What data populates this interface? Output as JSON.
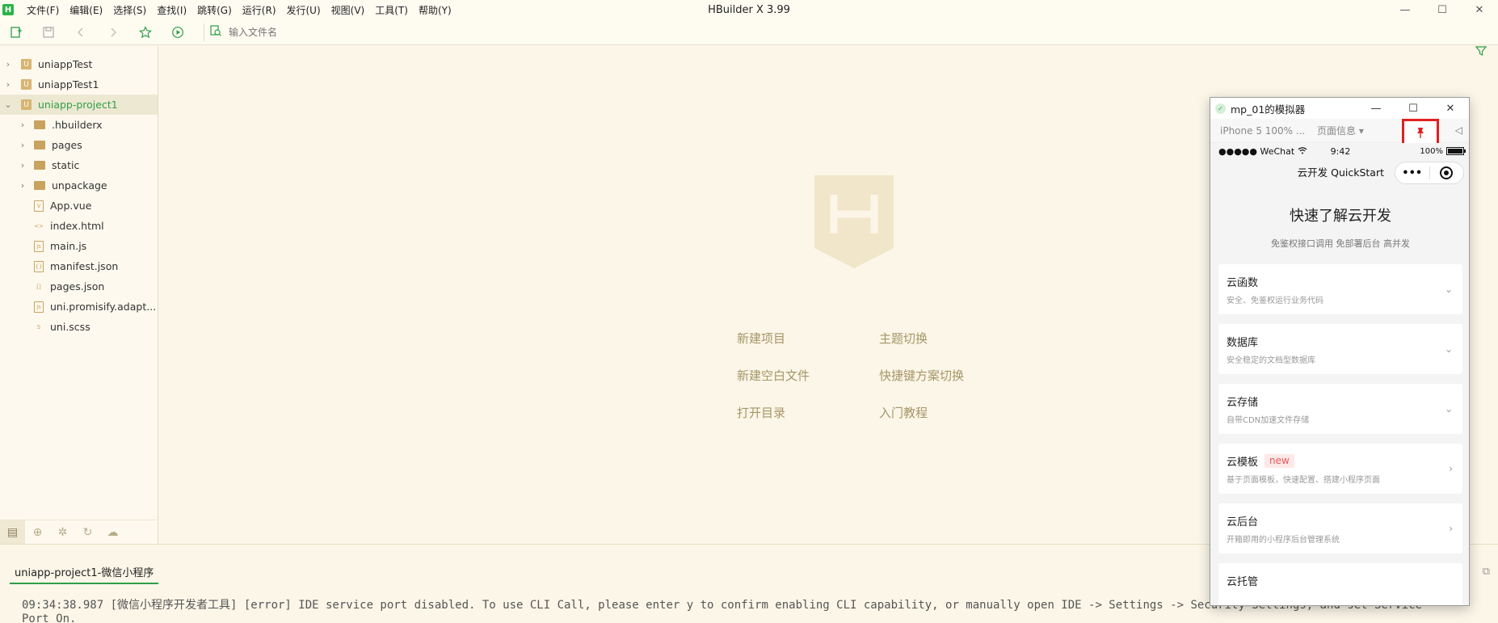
{
  "app": {
    "title": "HBuilder X 3.99",
    "logo_letter": "H",
    "menu": [
      "文件(F)",
      "编辑(E)",
      "选择(S)",
      "查找(I)",
      "跳转(G)",
      "运行(R)",
      "发行(U)",
      "视图(V)",
      "工具(T)",
      "帮助(Y)"
    ]
  },
  "toolbar": {
    "search_placeholder": "输入文件名"
  },
  "sidebar": {
    "projects": [
      {
        "label": "uniappTest",
        "expanded": false,
        "selected": false
      },
      {
        "label": "uniappTest1",
        "expanded": false,
        "selected": false
      },
      {
        "label": "uniapp-project1",
        "expanded": true,
        "selected": true
      }
    ],
    "folders": [
      ".hbuilderx",
      "pages",
      "static",
      "unpackage"
    ],
    "files": [
      {
        "label": "App.vue",
        "icon": "V"
      },
      {
        "label": "index.html",
        "icon": "<>"
      },
      {
        "label": "main.js",
        "icon": "js"
      },
      {
        "label": "manifest.json",
        "icon": "{}"
      },
      {
        "label": "pages.json",
        "icon": "[]"
      },
      {
        "label": "uni.promisify.adapt...",
        "icon": "js"
      },
      {
        "label": "uni.scss",
        "icon": "S"
      }
    ]
  },
  "welcome": {
    "links": [
      "新建项目",
      "主题切换",
      "新建空白文件",
      "快捷键方案切换",
      "打开目录",
      "入门教程"
    ]
  },
  "console": {
    "tab_label": "uniapp-project1-微信小程序",
    "line1": "09:34:38.987 [微信小程序开发者工具] [error] IDE service port disabled. To use CLI Call, please enter y to confirm enabling CLI capability, or manually open IDE -> Settings -> Security Settings, and set Service",
    "line2": "Port On."
  },
  "simulator": {
    "title": "mp_01的模拟器",
    "device": "iPhone 5 100% ...",
    "page_info": "页面信息 ▾",
    "status_left": "●●●●● WeChat",
    "time": "9:42",
    "battery_text": "100%",
    "battery_level": 1.0,
    "nav_title": "云开发 QuickStart",
    "capsule_more": "•••",
    "hero_title": "快速了解云开发",
    "hero_subtitle": "免鉴权接口调用 免部署后台 高并发",
    "cards": [
      {
        "title": "云函数",
        "desc": "安全、免鉴权运行业务代码",
        "chevron": "down"
      },
      {
        "title": "数据库",
        "desc": "安全稳定的文档型数据库",
        "chevron": "down"
      },
      {
        "title": "云存储",
        "desc": "自带CDN加速文件存储",
        "chevron": "down"
      },
      {
        "title": "云模板",
        "badge": "new",
        "desc": "基于页面模板，快速配置、搭建小程序页面",
        "chevron": "right"
      },
      {
        "title": "云后台",
        "desc": "开箱即用的小程序后台管理系统",
        "chevron": "right"
      },
      {
        "title": "云托管",
        "desc": "",
        "chevron": "right"
      }
    ]
  },
  "colors": {
    "accent_green": "#2e9f47",
    "highlight_red": "#e02020",
    "background": "#fbf6e8"
  }
}
